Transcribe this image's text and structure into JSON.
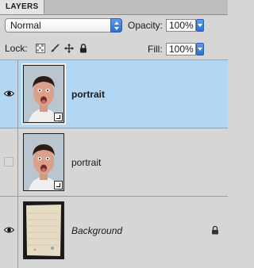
{
  "panel": {
    "tab_label": "LAYERS",
    "blend_mode": "Normal",
    "opacity_label": "Opacity:",
    "opacity_value": "100%",
    "lock_label": "Lock:",
    "fill_label": "Fill:",
    "fill_value": "100%"
  },
  "layers": [
    {
      "name": "portrait",
      "visible": true,
      "selected": true,
      "thumb": "face-portrait",
      "style": "bold"
    },
    {
      "name": "portrait",
      "visible": false,
      "selected": false,
      "thumb": "face-portrait",
      "style": "normal"
    },
    {
      "name": "Background",
      "visible": true,
      "selected": false,
      "thumb": "paper-texture",
      "style": "italic",
      "locked": true
    }
  ],
  "icons": {
    "lock_transparent": "checkerboard-icon",
    "lock_image": "brush-icon",
    "lock_position": "move-icon",
    "lock_all": "padlock-icon",
    "visibility": "eye-icon"
  },
  "colors": {
    "selected_row": "#b2d7f5",
    "panel_bg": "#d6d6d6",
    "accent": "#2a6fd3"
  }
}
